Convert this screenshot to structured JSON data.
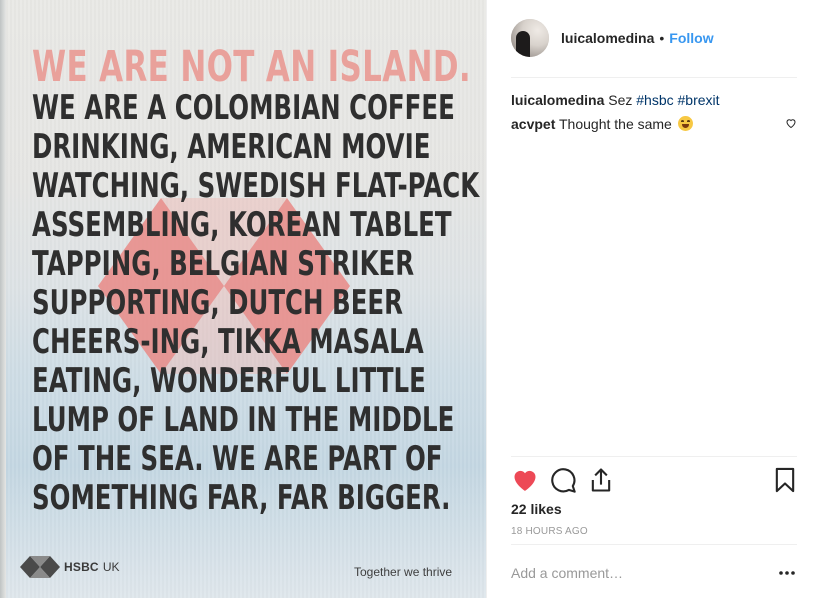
{
  "photo": {
    "headline_lines": [
      "WE ARE NOT AN ISLAND.",
      "WE ARE A COLOMBIAN COFFEE",
      "DRINKING, AMERICAN MOVIE",
      "WATCHING, SWEDISH FLAT-PACK",
      "ASSEMBLING, KOREAN TABLET",
      "TAPPING, BELGIAN STRIKER",
      "SUPPORTING, DUTCH BEER",
      "CHEERS-ING, TIKKA MASALA",
      "EATING, WONDERFUL LITTLE",
      "LUMP OF LAND IN THE MIDDLE",
      "OF THE SEA. WE ARE PART OF",
      "SOMETHING FAR, FAR BIGGER."
    ],
    "brand_name": "HSBC",
    "brand_suffix": "UK",
    "tagline": "Together we thrive",
    "colors": {
      "headline_accent": "#e9a19b",
      "hex_red": "#db0011"
    }
  },
  "post": {
    "username": "luicalomedina",
    "separator": "•",
    "follow_label": "Follow",
    "comments": [
      {
        "user": "luicalomedina",
        "text": "Sez",
        "hashtags": [
          "#hsbc",
          "#brexit"
        ]
      },
      {
        "user": "acvpet",
        "text": "Thought the same",
        "emoji": "grinning-squinting-face"
      }
    ],
    "likes": "22 likes",
    "time": "18 HOURS AGO",
    "add_comment_placeholder": "Add a comment…",
    "liked": true,
    "colors": {
      "link": "#3897f0",
      "hashtag": "#003569",
      "heart": "#ed4956"
    }
  }
}
